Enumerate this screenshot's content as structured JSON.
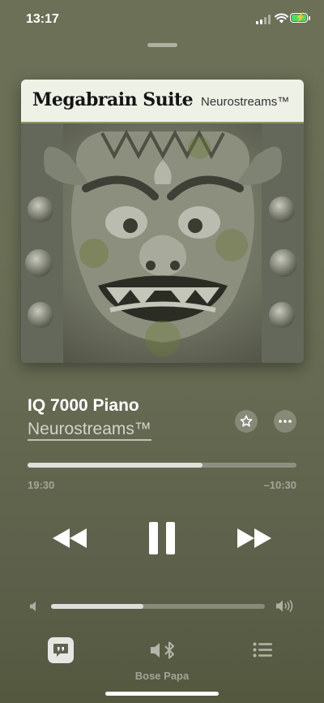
{
  "status_bar": {
    "time": "13:17"
  },
  "artwork": {
    "album_title": "Megabrain Suite",
    "brand": "Neurostreams™"
  },
  "now_playing": {
    "title": "IQ 7000 Piano",
    "artist": "Neurostreams™"
  },
  "progress": {
    "elapsed": "19:30",
    "remaining": "–10:30",
    "fraction": 0.65
  },
  "volume": {
    "fraction": 0.43
  },
  "bottom_bar": {
    "output_device": "Bose Papa"
  },
  "icons": {
    "favorite": "star-icon",
    "more": "ellipsis-icon",
    "previous": "rewind-icon",
    "pause": "pause-icon",
    "next": "fast-forward-icon",
    "volume_low": "speaker-low-icon",
    "volume_high": "speaker-high-icon",
    "lyrics": "lyrics-quote-icon",
    "output": "bluetooth-speaker-icon",
    "queue": "list-icon"
  },
  "colors": {
    "battery": "#4cd964",
    "background": "#6a6e55"
  }
}
